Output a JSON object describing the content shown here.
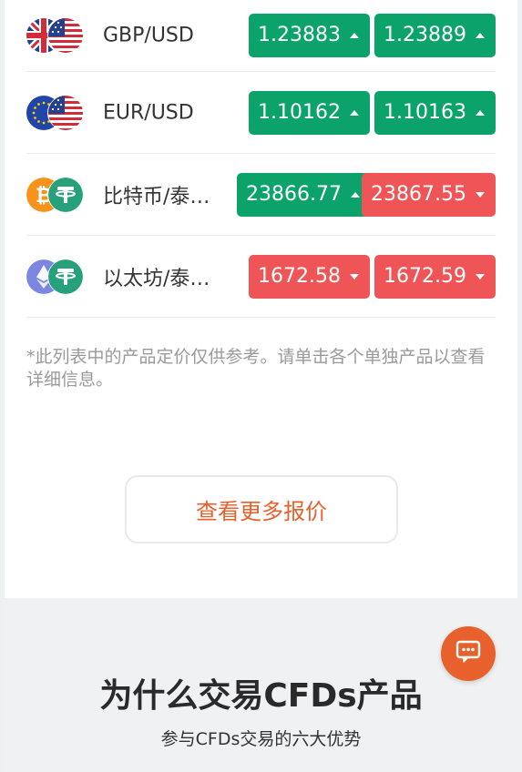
{
  "quotes": [
    {
      "pair": "GBP/USD",
      "flags": [
        "uk-flag-icon",
        "us-flag-icon"
      ],
      "bid": "1.23883",
      "bid_dir": "up",
      "ask": "1.23889",
      "ask_dir": "up"
    },
    {
      "pair": "EUR/USD",
      "flags": [
        "eu-flag-icon",
        "us-flag-icon"
      ],
      "bid": "1.10162",
      "bid_dir": "up",
      "ask": "1.10163",
      "ask_dir": "up"
    },
    {
      "pair": "比特币/泰…",
      "flags": [
        "bitcoin-icon",
        "tether-icon"
      ],
      "bid": "23866.77",
      "bid_dir": "up",
      "ask": "23867.55",
      "ask_dir": "down"
    },
    {
      "pair": "以太坊/泰…",
      "flags": [
        "ethereum-icon",
        "tether-icon"
      ],
      "bid": "1672.58",
      "bid_dir": "down",
      "ask": "1672.59",
      "ask_dir": "down"
    }
  ],
  "note": "*此列表中的产品定价仅供参考。请单击各个单独产品以查看详细信息。",
  "more_button": "查看更多报价",
  "why_section": {
    "title": "为什么交易CFDs产品",
    "subtitle": "参与CFDs交易的六大优势"
  },
  "chat_icon": "chat-bubble-icon",
  "colors": {
    "up": "#0ca36a",
    "down": "#ef5556",
    "accent": "#e8602c"
  }
}
